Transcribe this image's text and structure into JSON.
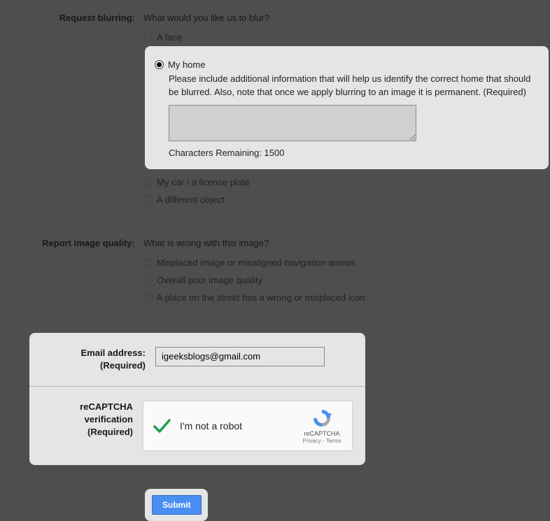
{
  "blurring": {
    "label": "Request blurring:",
    "question": "What would you like us to blur?",
    "option_face": "A face",
    "option_home": "My home",
    "option_car": "My car / a license plate",
    "option_object": "A different object",
    "home_helper": "Please include additional information that will help us identify the correct home that should be blurred. Also, note that once we apply blurring to an image it is permanent. (Required)",
    "char_remaining": "Characters Remaining: 1500"
  },
  "quality": {
    "label": "Report image quality:",
    "question": "What is wrong with this image?",
    "option_misplaced": "Misplaced image or misaligned navigation arrows",
    "option_poor": "Overall poor image quality",
    "option_icon": "A place on the street has a wrong or misplaced icon"
  },
  "email": {
    "label": "Email address:",
    "required": "(Required)",
    "value": "igeeksblogs@gmail.com"
  },
  "recaptcha": {
    "label": "reCAPTCHA verification",
    "required": "(Required)",
    "not_robot": "I'm not a robot",
    "brand": "reCAPTCHA",
    "privacy": "Privacy - Terms"
  },
  "submit": {
    "label": "Submit"
  }
}
